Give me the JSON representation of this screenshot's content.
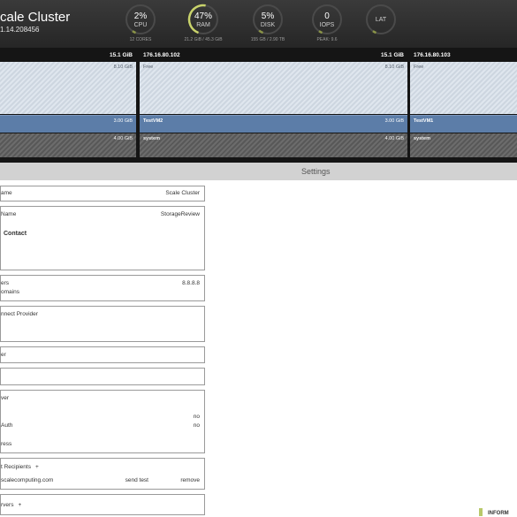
{
  "header": {
    "title": "cale Cluster",
    "version": "1.14.208456",
    "gauges": [
      {
        "value": "2%",
        "label": "CPU",
        "sub": "12 CORES",
        "fraction": 0.02,
        "color": "#8b9447"
      },
      {
        "value": "47%",
        "label": "RAM",
        "sub": "21.2 GiB / 45.3 GiB",
        "fraction": 0.47,
        "color": "#c9d36b"
      },
      {
        "value": "5%",
        "label": "DISK",
        "sub": "155 GB / 2.90 TB",
        "fraction": 0.05,
        "color": "#8b9447"
      },
      {
        "value": "0",
        "label": "IOPS",
        "sub": "PEAK: 9.6",
        "fraction": 0.0,
        "color": "#8b9447"
      },
      {
        "value": "",
        "label": "LAT",
        "sub": "",
        "fraction": 0.0,
        "color": "#8b9447"
      }
    ]
  },
  "nodes": [
    {
      "ip": "",
      "capacity": "15.1 GiB",
      "free_label": "",
      "free_size": "8.10 GiB",
      "vm_label": "",
      "vm_size": "3.00 GiB",
      "sys_label": "",
      "sys_size": "4.00 GiB"
    },
    {
      "ip": "176.16.80.102",
      "capacity": "15.1 GiB",
      "free_label": "Free",
      "free_size": "8.10 GiB",
      "vm_label": "TestVM2",
      "vm_size": "3.00 GiB",
      "sys_label": "system",
      "sys_size": "4.00 GiB"
    },
    {
      "ip": "176.16.80.103",
      "capacity": "",
      "free_label": "Free",
      "free_size": "",
      "vm_label": "TestVM1",
      "vm_size": "",
      "sys_label": "system",
      "sys_size": ""
    }
  ],
  "settings": {
    "title": "Settings",
    "cluster_name_label": "ame",
    "cluster_name_value": "Scale Cluster",
    "company_name_label": "Name",
    "company_name_value": "StorageReview",
    "contact_label": "Contact",
    "dns_servers_label": "ers",
    "dns_servers_value": "8.8.8.8",
    "dns_domains_label": "omains",
    "remote_support_label": "nnect Provider",
    "box5_label": "er",
    "box6_label": "",
    "smtp_server_label": "ver",
    "smtp_value_1": "no",
    "smtp_auth_label": "Auth",
    "smtp_value_2": "no",
    "from_address_label": "ress",
    "alert_recipients_label": "t Recipients",
    "add_symbol": "+",
    "recipient_email": "scalecomputing.com",
    "send_test_label": "send test",
    "remove_label": "remove",
    "syslog_label": "rvers",
    "information_label": "INFORM"
  }
}
